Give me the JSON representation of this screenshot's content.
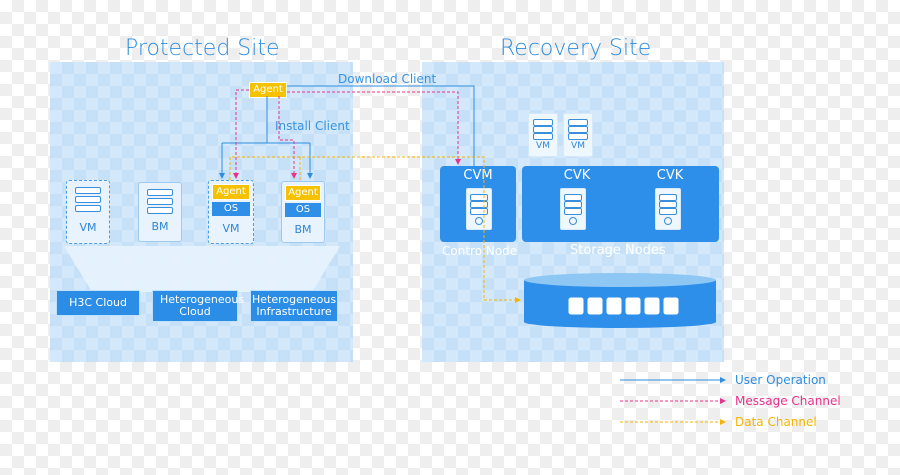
{
  "titles": {
    "protected": "Protected Site",
    "recovery": "Recovery Site"
  },
  "protected": {
    "agent_top": "Agent",
    "download_client": "Download Client",
    "install_client": "Install Client",
    "vm1": "VM",
    "bm": "BM",
    "agent_vm": "Agent",
    "os_vm": "OS",
    "vm2": "VM",
    "agent_bm": "Agent",
    "os_bm": "OS",
    "bm2": "BM",
    "clouds": [
      "H3C Cloud",
      "Heterogeneous Cloud",
      "Heterogeneous Infrastructure"
    ]
  },
  "recovery": {
    "vm_small_1": "VM",
    "vm_small_2": "VM",
    "cvm": "CVM",
    "cvk1": "CVK",
    "cvk2": "CVK",
    "control_node": "Contro Node",
    "storage_nodes": "Storage Nodes"
  },
  "legend": {
    "items": [
      {
        "label": "User Operation",
        "color": "#2d8ee0"
      },
      {
        "label": "Message Channel",
        "color": "#e8338b"
      },
      {
        "label": "Data Channel",
        "color": "#f6b400"
      }
    ]
  },
  "colors": {
    "accent_blue": "#2d8ee0",
    "message_pink": "#e8338b",
    "data_yellow": "#f6b400"
  }
}
